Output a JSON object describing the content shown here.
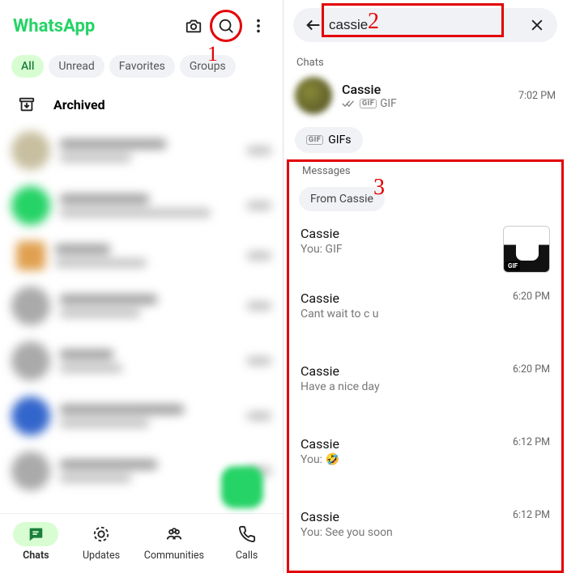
{
  "brand": "WhatsApp",
  "annotations": {
    "a1": "1",
    "a2": "2",
    "a3": "3"
  },
  "filters": {
    "all": "All",
    "unread": "Unread",
    "favorites": "Favorites",
    "groups": "Groups"
  },
  "archived_label": "Archived",
  "tabs": {
    "chats": "Chats",
    "updates": "Updates",
    "communities": "Communities",
    "calls": "Calls"
  },
  "search": {
    "value": "cassie"
  },
  "right": {
    "chats_label": "Chats",
    "top_chat": {
      "name": "Cassie",
      "sub": "GIF",
      "time": "7:02 PM"
    },
    "gifs_chip": "GIFs",
    "messages_label": "Messages",
    "from_chip": "From Cassie",
    "messages": [
      {
        "name": "Cassie",
        "preview": "You: GIF",
        "time": "",
        "thumb": true
      },
      {
        "name": "Cassie",
        "preview": "Cant wait to c u",
        "time": "6:20 PM",
        "thumb": false
      },
      {
        "name": "Cassie",
        "preview": "Have a nice day",
        "time": "6:20 PM",
        "thumb": false
      },
      {
        "name": "Cassie",
        "preview": "You: 🤣",
        "time": "6:12 PM",
        "thumb": false
      },
      {
        "name": "Cassie",
        "preview": "You: See you soon",
        "time": "6:12 PM",
        "thumb": false
      }
    ]
  }
}
